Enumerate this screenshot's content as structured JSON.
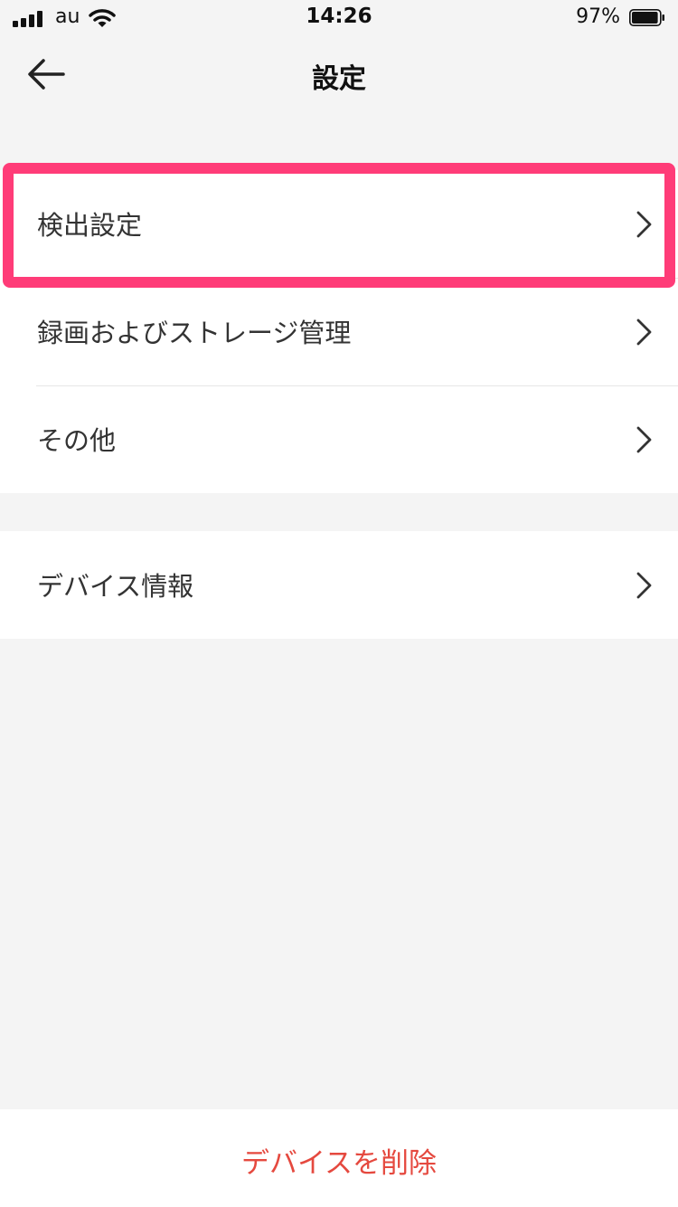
{
  "status_bar": {
    "carrier": "au",
    "time": "14:26",
    "battery_percent": "97%",
    "battery_level": 0.97,
    "icons": [
      "signal-icon",
      "wifi-icon",
      "battery-icon"
    ]
  },
  "nav": {
    "title": "設定",
    "back_icon": "arrow-left-icon"
  },
  "menu": {
    "group1": [
      {
        "label": "検出設定",
        "highlighted": true
      },
      {
        "label": "録画およびストレージ管理"
      },
      {
        "label": "その他"
      }
    ],
    "group2": [
      {
        "label": "デバイス情報"
      }
    ],
    "chevron_icon": "chevron-right-icon"
  },
  "footer": {
    "delete_label": "デバイスを削除"
  },
  "colors": {
    "background": "#f4f4f4",
    "highlight": "#ff3c78",
    "danger": "#e5493f"
  }
}
